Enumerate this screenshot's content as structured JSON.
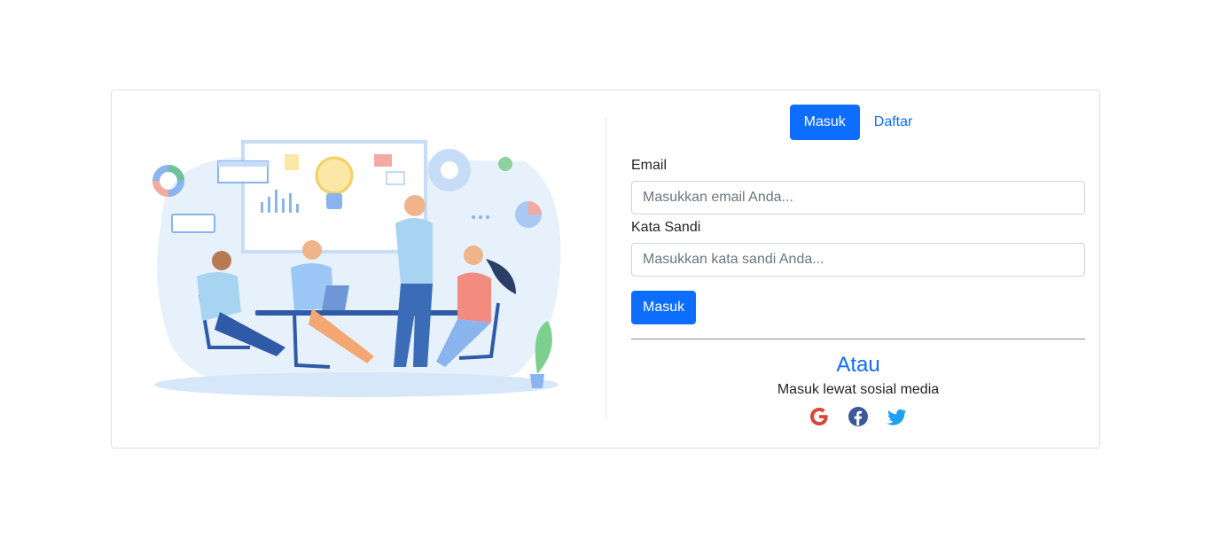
{
  "tabs": {
    "login": "Masuk",
    "register": "Daftar"
  },
  "form": {
    "email_label": "Email",
    "email_placeholder": "Masukkan email Anda...",
    "password_label": "Kata Sandi",
    "password_placeholder": "Masukkan kata sandi Anda...",
    "submit_label": "Masuk"
  },
  "social": {
    "heading": "Atau",
    "subtext": "Masuk lewat sosial media",
    "icons": [
      "google-icon",
      "facebook-icon",
      "twitter-icon"
    ]
  },
  "colors": {
    "primary": "#0d6efd",
    "google": "#db4437",
    "facebook": "#3b5998",
    "twitter": "#1da1f2"
  }
}
